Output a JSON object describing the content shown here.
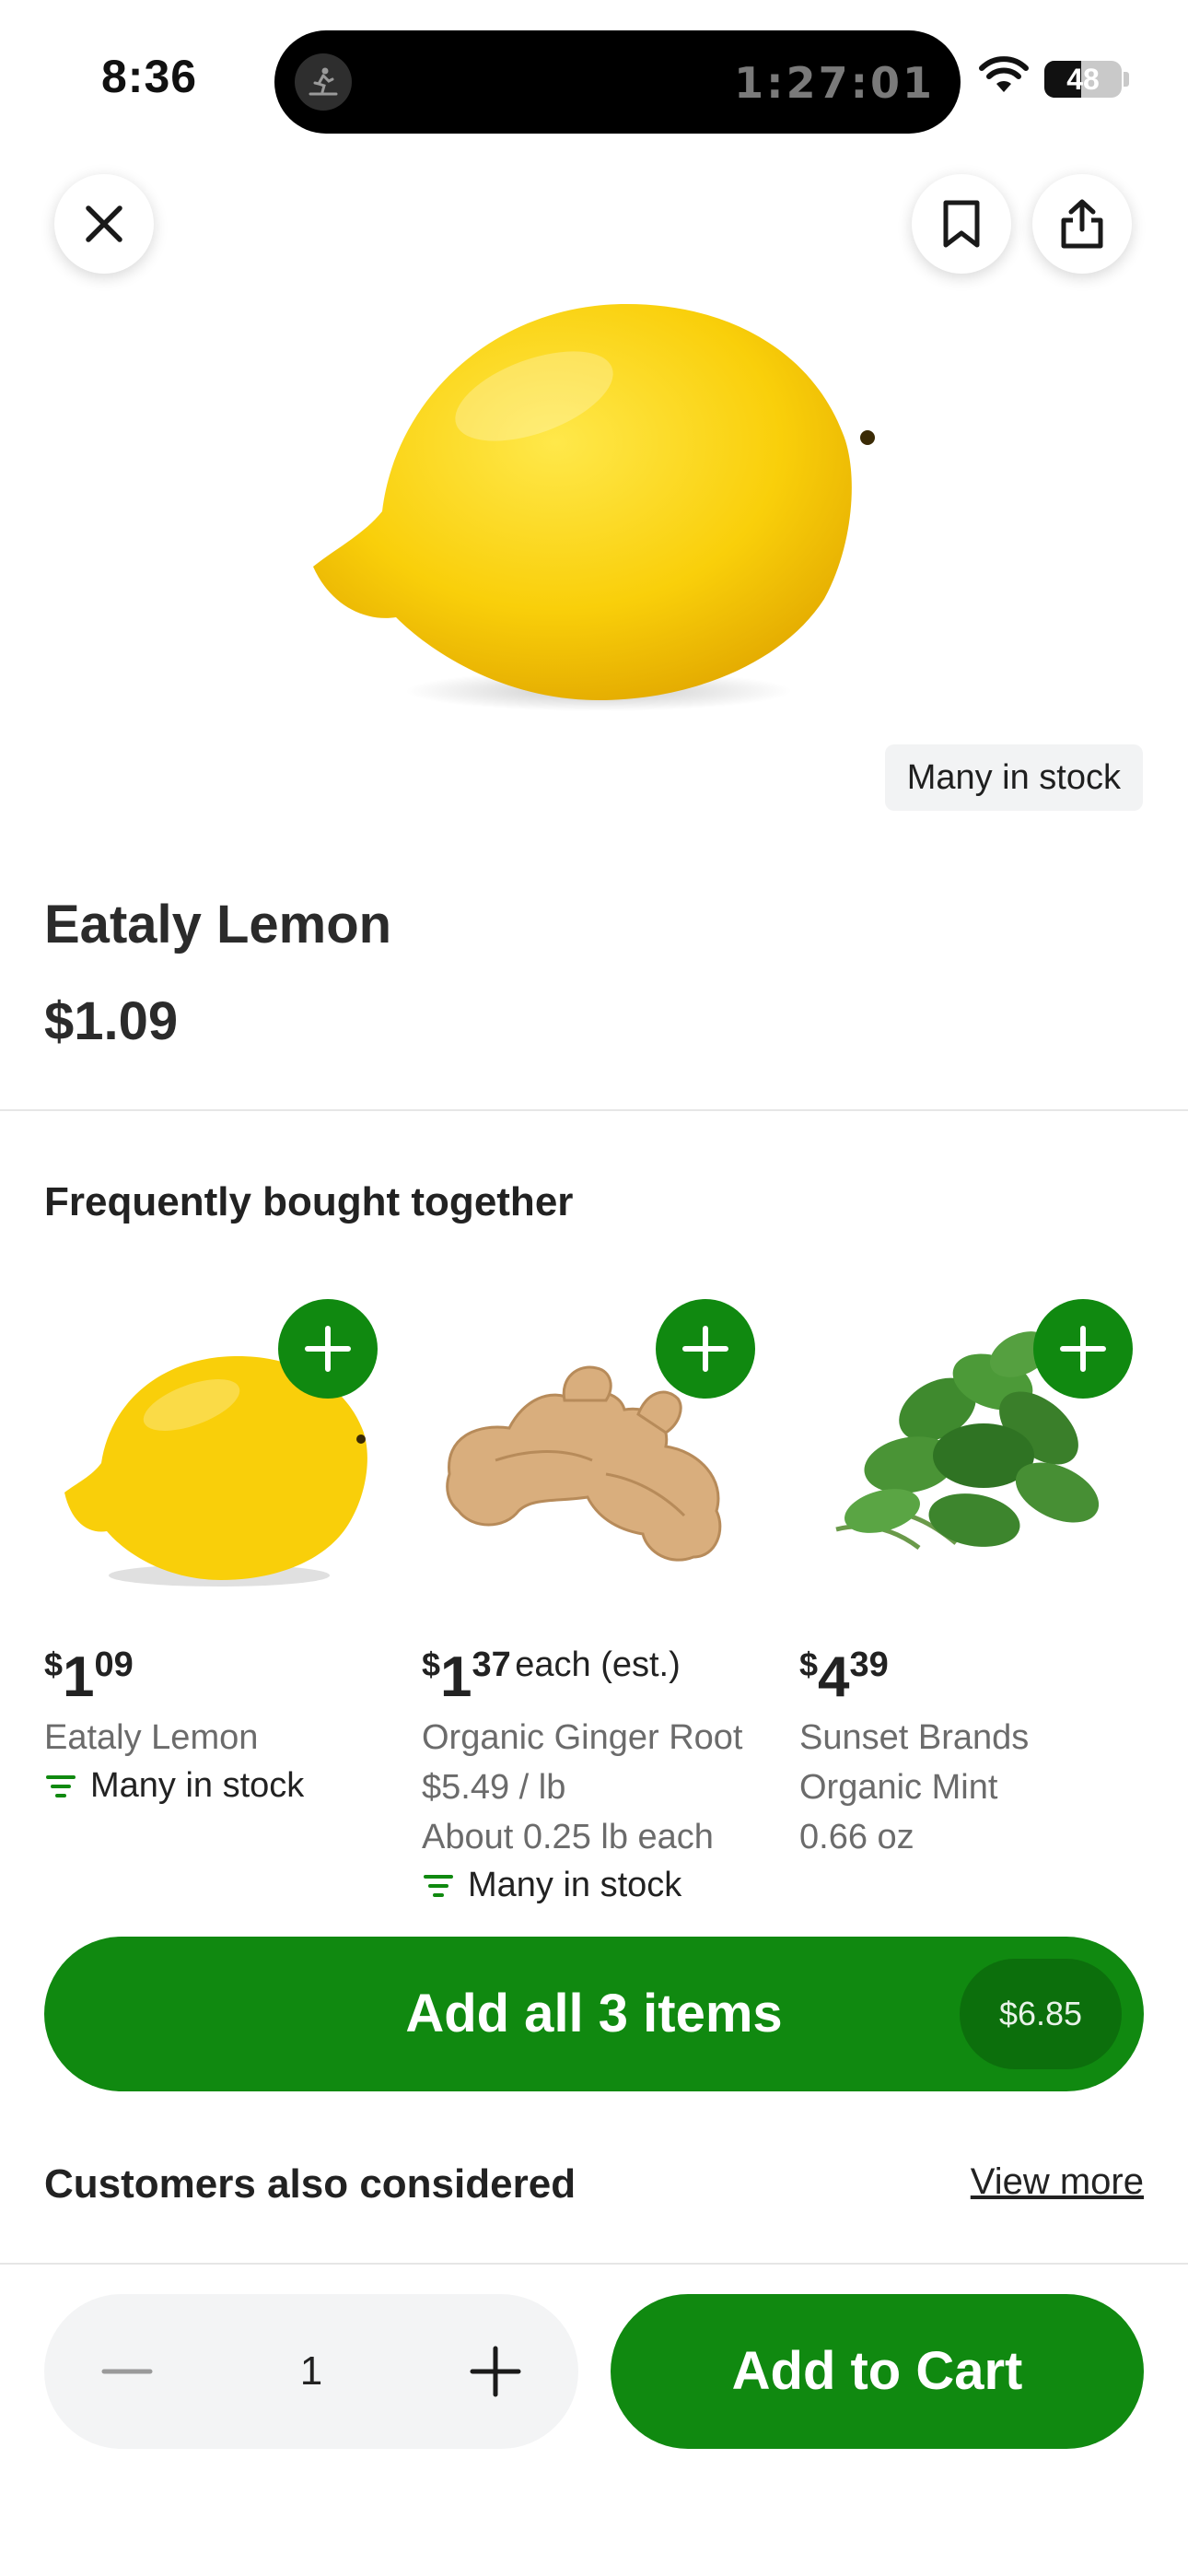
{
  "status_bar": {
    "time": "8:36",
    "timer": "1:27:01",
    "battery_level": "48",
    "battery_fraction": 0.48
  },
  "header": {
    "close_icon": "close-icon",
    "bookmark_icon": "bookmark-icon",
    "share_icon": "share-icon"
  },
  "product": {
    "stock_badge": "Many in stock",
    "title": "Eataly Lemon",
    "price": "$1.09"
  },
  "fbt": {
    "title": "Frequently bought together",
    "items": [
      {
        "currency": "$",
        "dollars": "1",
        "cents": "09",
        "suffix": "",
        "lines": [
          "Eataly Lemon"
        ],
        "stock": "Many in stock"
      },
      {
        "currency": "$",
        "dollars": "1",
        "cents": "37",
        "suffix": "each (est.)",
        "lines": [
          "Organic Ginger Root",
          "$5.49 / lb",
          "About 0.25 lb each"
        ],
        "stock": "Many in stock"
      },
      {
        "currency": "$",
        "dollars": "4",
        "cents": "39",
        "suffix": "",
        "lines": [
          "Sunset Brands",
          "Organic Mint",
          "0.66 oz"
        ],
        "stock": ""
      }
    ],
    "add_all_label": "Add all 3 items",
    "add_all_total": "$6.85"
  },
  "also_considered": {
    "title": "Customers also considered",
    "view_more": "View more"
  },
  "bottom_bar": {
    "quantity": "1",
    "add_to_cart": "Add to Cart"
  },
  "colors": {
    "brand_green": "#108910",
    "lemon_yellow": "#f9cf0a"
  }
}
